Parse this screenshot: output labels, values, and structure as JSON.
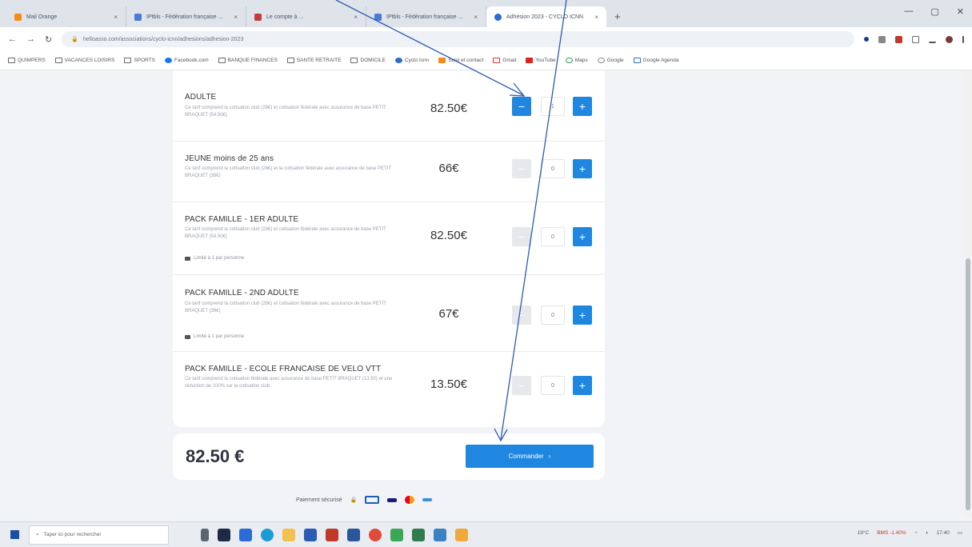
{
  "browser": {
    "tabs": [
      {
        "label": "Mail Orange",
        "active": false
      },
      {
        "label": "IPtbls - Fédération française ...",
        "active": false
      },
      {
        "label": "Le compte à ...",
        "active": false
      },
      {
        "label": "IPtbls - Fédération française ...",
        "active": false
      },
      {
        "label": "Adhésion 2023 - CYCLO ICNN",
        "active": true
      }
    ],
    "new_tab": "+",
    "window_controls": [
      "—",
      "▢",
      "✕"
    ],
    "url": "helloasso.com/associations/cyclo-icnn/adhesions/adhesion-2023",
    "bookmarks": [
      "QUIMPERS",
      "VACANCES LOISIRS",
      "SPORTS",
      "Facebook.com",
      "BANQUE FINANCES",
      "SANTE RETRAITE",
      "DOMICILE",
      "Cyclo Icnn",
      "Suivi et contact",
      "Gmail",
      "YouTube",
      "Maps",
      "Google",
      "Google Agenda"
    ]
  },
  "items": [
    {
      "title": "ADULTE",
      "desc": "Ce tarif comprend la cotisation club (28€) et cotisation fédérale avec assurance de base PETIT BRAQUET (54.50€)",
      "price": "82.50€",
      "qty": "1",
      "minus_on": true,
      "limit": ""
    },
    {
      "title": "JEUNE moins de 25 ans",
      "desc": "Ce tarif comprend la cotisation club (28€) et la cotisation fédérale avec assurance de base PETIT BRAQUET (38€)",
      "price": "66€",
      "qty": "0",
      "minus_on": false,
      "limit": ""
    },
    {
      "title": "PACK FAMILLE - 1ER ADULTE",
      "desc": "Ce tarif comprend la cotisation club (28€) et cotisation fédérale avec assurance de base PETIT BRAQUET (54.50€)",
      "price": "82.50€",
      "qty": "0",
      "minus_on": false,
      "limit": "Limité à 1 par personne"
    },
    {
      "title": "PACK FAMILLE - 2ND ADULTE",
      "desc": "Ce tarif comprend la cotisation club (28€) et cotisation fédérale avec assurance de base PETIT BRAQUET (39€)",
      "price": "67€",
      "qty": "0",
      "minus_on": false,
      "limit": "Limité à 1 par personne"
    },
    {
      "title": "PACK FAMILLE - ECOLE FRANCAISE DE VELO VTT",
      "desc": "Ce tarif comprend la cotisation fédérale avec assurance de base PETIT BRAQUET (13.50) et une réduction de 100% sur la cotisation club.",
      "price": "13.50€",
      "qty": "0",
      "minus_on": false,
      "limit": ""
    }
  ],
  "buttons": {
    "minus": "−",
    "plus": "+"
  },
  "total": "82.50 €",
  "order_label": "Commander",
  "order_arrow": "›",
  "payment_label": "Paiement sécurisé",
  "taskbar": {
    "search_placeholder": "Taper ici pour rechercher",
    "weather": "19°C",
    "tray_status": "BMS -1.40%",
    "time": "17:40"
  },
  "colors": {
    "accent": "#1f87e0",
    "annotation": "#2a5bb5"
  }
}
